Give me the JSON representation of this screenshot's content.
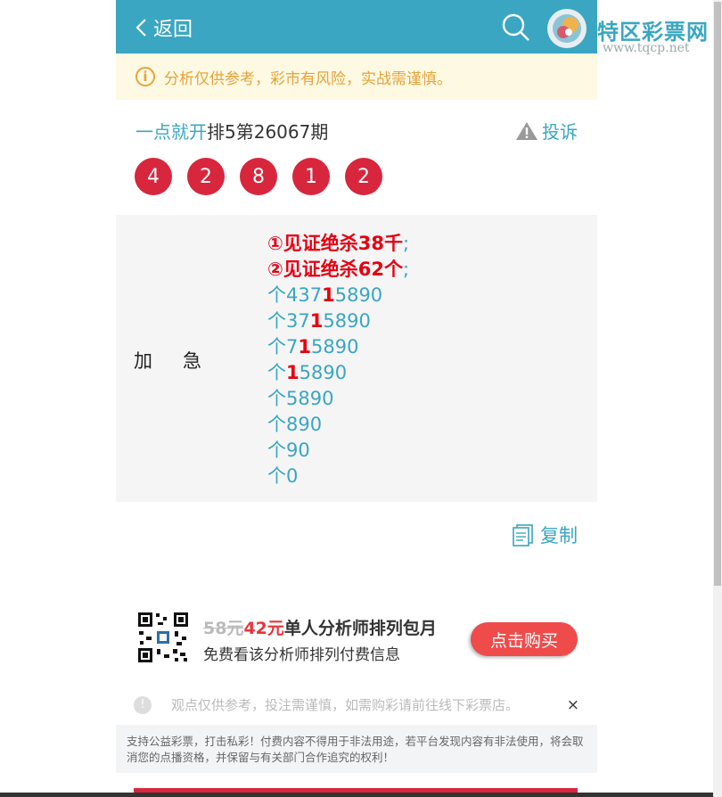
{
  "header": {
    "back_label": "返回"
  },
  "watermark": {
    "brand": "特区彩票网",
    "url": "www.tqcp.net"
  },
  "notice": {
    "icon": "i",
    "text": "分析仅供参考，彩市有风险，实战需谨慎。"
  },
  "issue": {
    "analyst": "一点就开",
    "title": "排5第26067期",
    "complain_label": "投诉"
  },
  "balls": [
    "4",
    "2",
    "8",
    "1",
    "2"
  ],
  "content": {
    "label": "加急",
    "kill_lines": [
      "①见证绝杀38千",
      "②见证绝杀62个"
    ],
    "semi": ";",
    "ge_prefix": "个",
    "ge_lines": [
      {
        "pre": "437",
        "hit": "1",
        "post": "5890"
      },
      {
        "pre": "37",
        "hit": "1",
        "post": "5890"
      },
      {
        "pre": "7",
        "hit": "1",
        "post": "5890"
      },
      {
        "pre": "",
        "hit": "1",
        "post": "5890"
      },
      {
        "pre": "5890",
        "hit": "",
        "post": ""
      },
      {
        "pre": "890",
        "hit": "",
        "post": ""
      },
      {
        "pre": "90",
        "hit": "",
        "post": ""
      },
      {
        "pre": "0",
        "hit": "",
        "post": ""
      }
    ]
  },
  "copy_label": "复制",
  "promo": {
    "old_price": "58元",
    "new_price": "42元",
    "title": "单人分析师排列包月",
    "subtitle": "免费看该分析师排列付费信息",
    "buy_label": "点击购买"
  },
  "tip": {
    "icon": "!",
    "text": "观点仅供参考，投注需谨慎，如需购彩请前往线下彩票店。",
    "close": "×"
  },
  "legal": "支持公益彩票，打击私彩！付费内容不得用于非法用途，若平台发现内容有非法使用，将会取消您的点播资格，并保留与有关部门合作追究的权利！",
  "colors": {
    "accent": "#3aa6c2",
    "ball": "#d8263d",
    "hit": "#e60012",
    "buy": "#ef4b4b"
  }
}
